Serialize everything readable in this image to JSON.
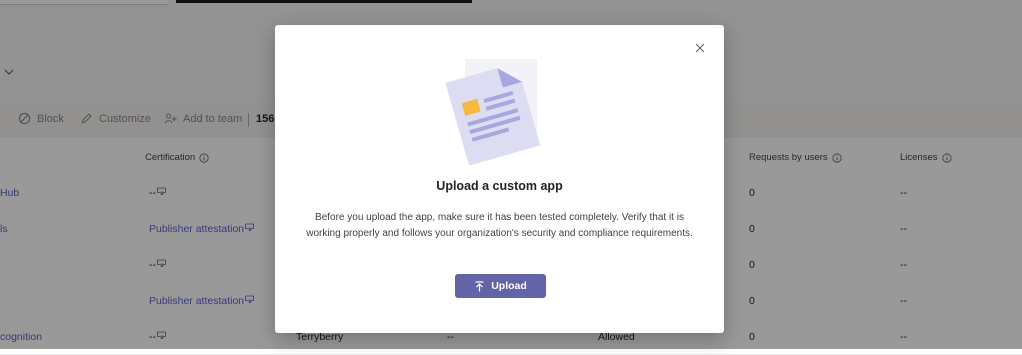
{
  "toolbar": {
    "block_label": "Block",
    "customize_label": "Customize",
    "add_to_team_label": "Add to team",
    "count": "156"
  },
  "table": {
    "headers": {
      "certification": "Certification",
      "requests_by_users": "Requests by users",
      "licenses": "Licenses"
    },
    "rows": [
      {
        "name": "Hub",
        "certification": "--",
        "cert_link": false,
        "publisher": "",
        "permissions": "",
        "status": "",
        "requests": "0",
        "licenses": "--"
      },
      {
        "name": "ls",
        "certification": "Publisher attestation",
        "cert_link": true,
        "publisher": "",
        "permissions": "",
        "status": "",
        "requests": "0",
        "licenses": "--"
      },
      {
        "name": "",
        "certification": "--",
        "cert_link": false,
        "publisher": "",
        "permissions": "",
        "status": "",
        "requests": "0",
        "licenses": "--"
      },
      {
        "name": "",
        "certification": "Publisher attestation",
        "cert_link": true,
        "publisher": "",
        "permissions": "",
        "status": "",
        "requests": "0",
        "licenses": "--"
      },
      {
        "name": "cognition",
        "certification": "--",
        "cert_link": false,
        "publisher": "Terryberry",
        "permissions": "--",
        "status": "Allowed",
        "requests": "0",
        "licenses": "--"
      }
    ]
  },
  "dialog": {
    "title": "Upload a custom app",
    "body": "Before you upload the app, make sure it has been tested completely. Verify that it is working properly and follows your organization's security and compliance requirements.",
    "upload_label": "Upload"
  },
  "colors": {
    "accent": "#6264a7",
    "link": "#5b5fc7",
    "overlay": "rgba(0,0,0,0.40)"
  },
  "icons": {
    "close": "close-icon",
    "upload": "upload-arrow-icon",
    "info": "info-icon",
    "block": "block-icon",
    "customize": "pencil-icon",
    "add_to_team": "people-add-icon",
    "certification": "certificate-icon"
  }
}
